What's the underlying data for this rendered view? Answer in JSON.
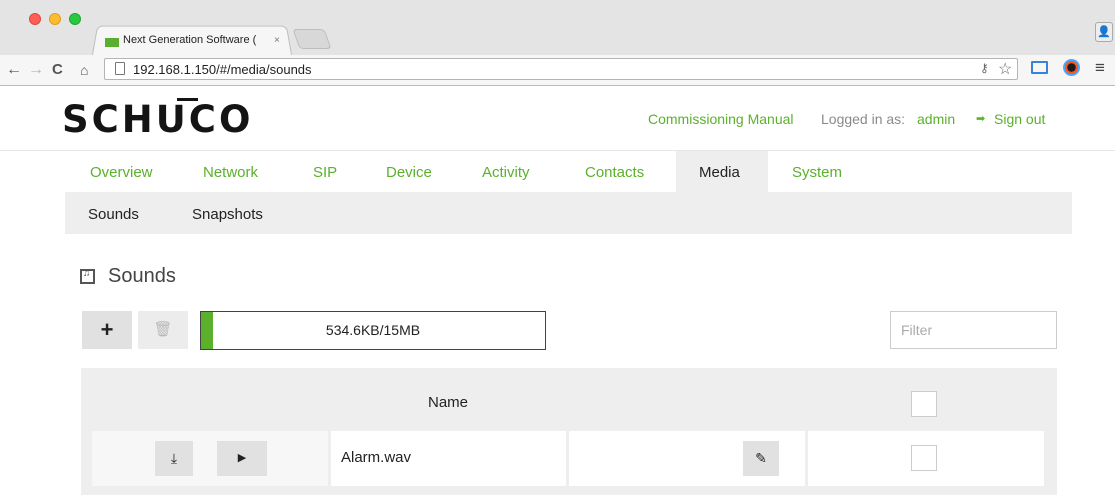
{
  "browser": {
    "tab_title": "Next Generation Software (",
    "tab_close": "×",
    "url": "192.168.1.150/#/media/sounds",
    "profile_glyph": "👤"
  },
  "brand": {
    "logo": "SCHUCO"
  },
  "header": {
    "manual_link": "Commissioning Manual",
    "logged_in_label": "Logged in as:",
    "username": "admin",
    "sign_out": "Sign out"
  },
  "nav": {
    "tabs": [
      "Overview",
      "Network",
      "SIP",
      "Device",
      "Activity",
      "Contacts",
      "Media",
      "System"
    ],
    "active": "Media"
  },
  "subnav": {
    "tabs": [
      "Sounds",
      "Snapshots"
    ],
    "active": "Sounds"
  },
  "section": {
    "title": "Sounds"
  },
  "storage": {
    "usage_text": "534.6KB/15MB",
    "used_fraction": 0.035,
    "fill_color": "#5bb12b"
  },
  "filter": {
    "placeholder": "Filter",
    "value": ""
  },
  "table": {
    "header_name": "Name",
    "rows": [
      {
        "name": "Alarm.wav"
      }
    ]
  },
  "colors": {
    "accent": "#5bb12b",
    "panel": "#eeeeee"
  }
}
